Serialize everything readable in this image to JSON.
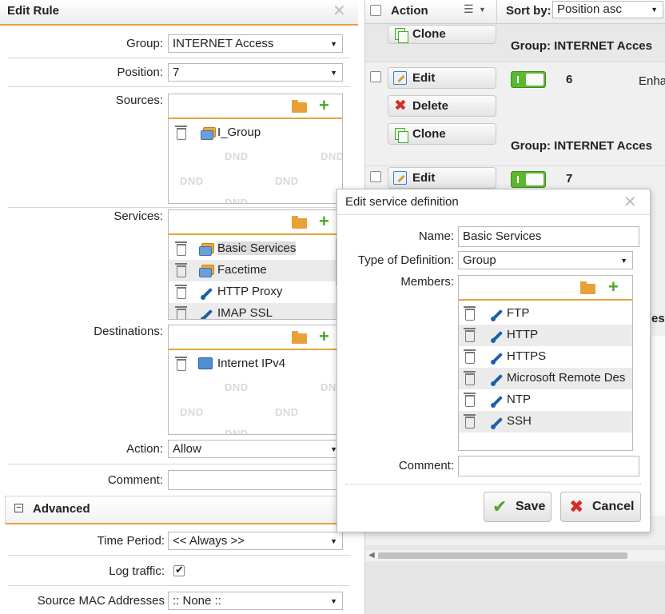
{
  "edit_rule": {
    "title": "Edit Rule",
    "group_label": "Group:",
    "group_value": "INTERNET Access",
    "position_label": "Position:",
    "position_value": "7",
    "sources_label": "Sources:",
    "sources_items": [
      {
        "label": "I_Group"
      }
    ],
    "services_label": "Services:",
    "services_items": [
      {
        "label": "Basic Services"
      },
      {
        "label": "Facetime"
      },
      {
        "label": "HTTP Proxy"
      },
      {
        "label": "IMAP SSL"
      }
    ],
    "destinations_label": "Destinations:",
    "destinations_items": [
      {
        "label": "Internet IPv4"
      }
    ],
    "dnd_text": "DND",
    "action_label": "Action:",
    "action_value": "Allow",
    "comment_label": "Comment:",
    "comment_value": "",
    "advanced_label": "Advanced",
    "time_period_label": "Time Period:",
    "time_period_value": "<< Always >>",
    "log_traffic_label": "Log traffic:",
    "log_traffic_checked": true,
    "source_mac_label": "Source MAC Addresses",
    "source_mac_value": ":: None ::"
  },
  "rules_list": {
    "action_header": "Action",
    "sort_label": "Sort by:",
    "sort_value": "Position asc",
    "edit_label": "Edit",
    "delete_label": "Delete",
    "clone_label": "Clone",
    "group_prefix": "Group: INTERNET Acces",
    "rows": [
      {
        "position": "6",
        "text": "Enha"
      },
      {
        "position": "7"
      }
    ],
    "partial_text_es": "es"
  },
  "dialog": {
    "title": "Edit service definition",
    "name_label": "Name:",
    "name_value": "Basic Services",
    "type_label": "Type of Definition:",
    "type_value": "Group",
    "members_label": "Members:",
    "members": [
      {
        "label": "FTP"
      },
      {
        "label": "HTTP"
      },
      {
        "label": "HTTPS"
      },
      {
        "label": "Microsoft Remote Des"
      },
      {
        "label": "NTP"
      },
      {
        "label": "SSH"
      }
    ],
    "comment_label": "Comment:",
    "comment_value": "",
    "save_label": "Save",
    "cancel_label": "Cancel"
  },
  "colors": {
    "accent_orange": "#e8a33c",
    "add_green": "#4aa72c",
    "delete_red": "#d62b1f",
    "toggle_green": "#5cb82e"
  }
}
